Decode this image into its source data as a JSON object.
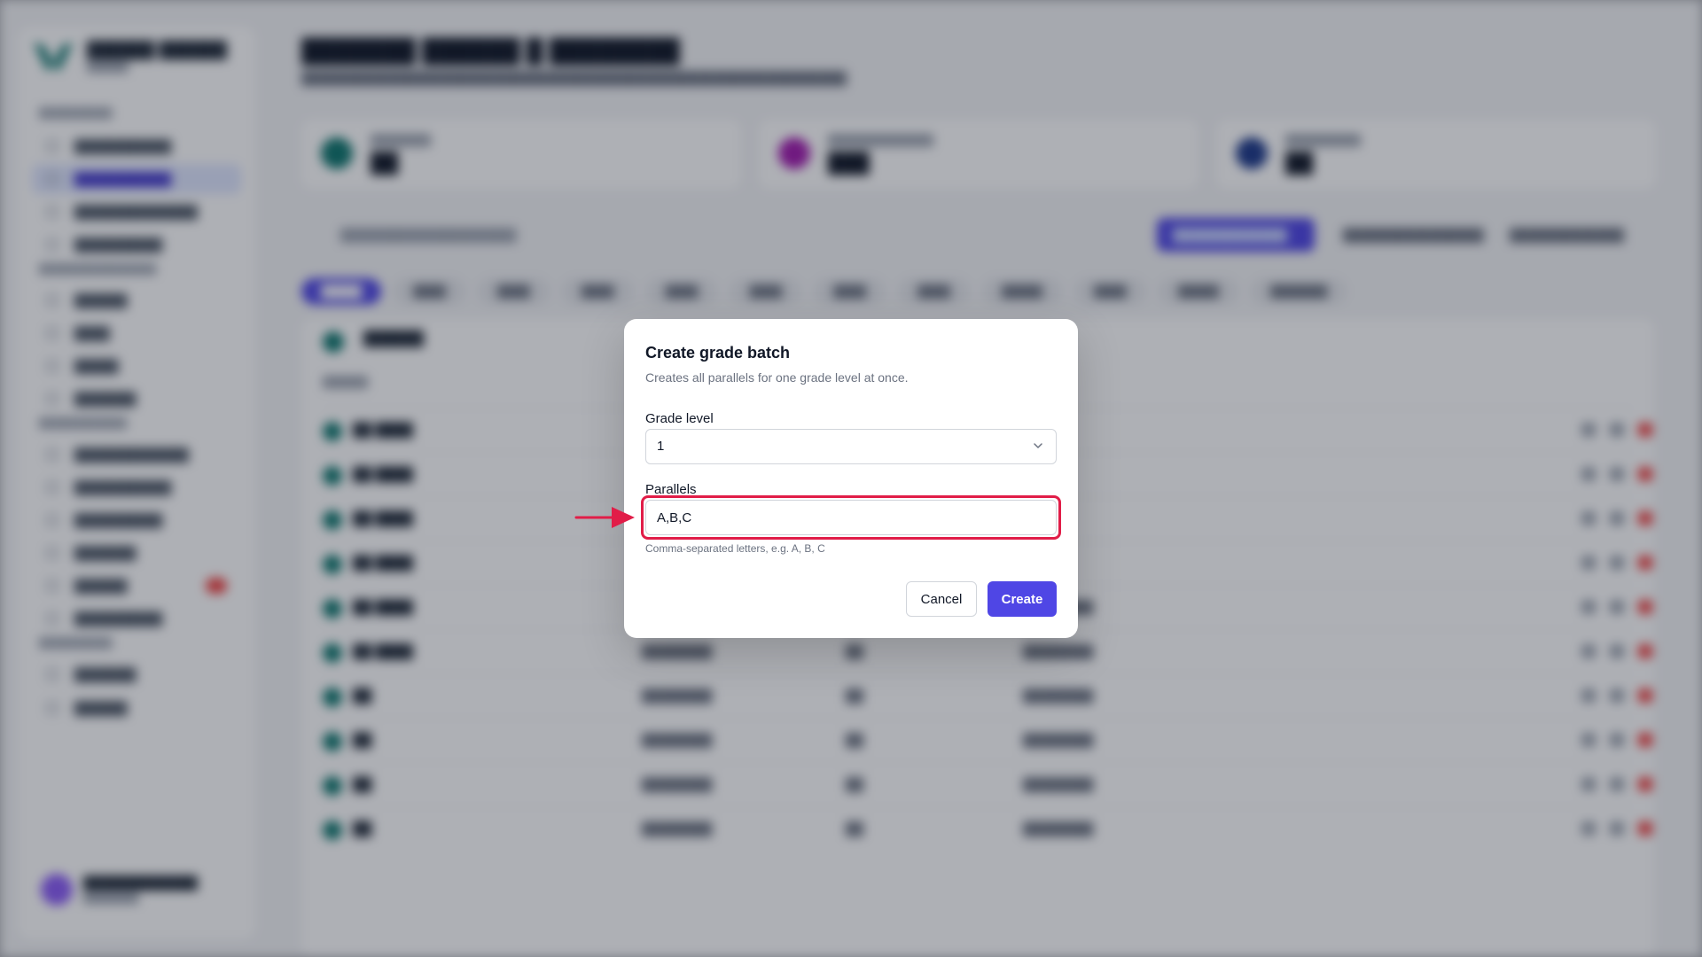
{
  "background": {
    "sidebar": {
      "items": [
        "",
        "",
        "",
        "",
        "",
        "",
        "",
        "",
        "",
        "",
        "",
        "",
        "",
        ""
      ]
    },
    "filter_pills": [
      "",
      "",
      "",
      "",
      "",
      "",
      "",
      "",
      "",
      "",
      "",
      "",
      ""
    ]
  },
  "modal": {
    "title": "Create grade batch",
    "description": "Creates all parallels for one grade level at once.",
    "grade_level": {
      "label": "Grade level",
      "value": "1"
    },
    "parallels": {
      "label": "Parallels",
      "value": "A,B,C",
      "hint": "Comma-separated letters, e.g. A, B, C"
    },
    "cancel_label": "Cancel",
    "create_label": "Create"
  },
  "colors": {
    "accent": "#4f46e5",
    "highlight": "#e11d48",
    "overlay": "rgba(17,24,39,0.34)"
  },
  "icons": {
    "select_chevron": "chevron-down-icon",
    "annotation_arrow": "arrow-right-icon"
  }
}
